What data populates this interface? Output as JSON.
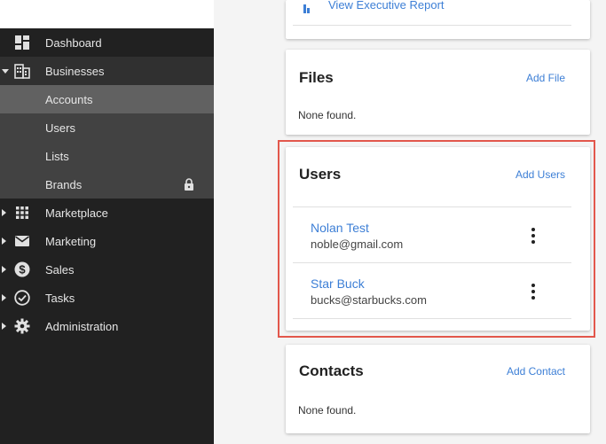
{
  "sidebar": {
    "items": [
      {
        "label": "Dashboard",
        "icon": "dashboard-icon",
        "caret": ""
      },
      {
        "label": "Businesses",
        "icon": "building-icon",
        "caret": "down"
      },
      {
        "label": "Accounts",
        "sub": true,
        "active": true
      },
      {
        "label": "Users",
        "sub": true
      },
      {
        "label": "Lists",
        "sub": true
      },
      {
        "label": "Brands",
        "sub": true,
        "locked": true
      },
      {
        "label": "Marketplace",
        "icon": "grid-icon",
        "caret": "right"
      },
      {
        "label": "Marketing",
        "icon": "mail-icon",
        "caret": "right"
      },
      {
        "label": "Sales",
        "icon": "dollar-icon",
        "caret": "right"
      },
      {
        "label": "Tasks",
        "icon": "check-circle-icon",
        "caret": "right"
      },
      {
        "label": "Administration",
        "icon": "gear-icon",
        "caret": "right"
      }
    ]
  },
  "report": {
    "link_label": "View Executive Report"
  },
  "files": {
    "title": "Files",
    "action": "Add File",
    "empty": "None found."
  },
  "users": {
    "title": "Users",
    "action": "Add Users",
    "rows": [
      {
        "name": "Nolan Test",
        "email": "noble@gmail.com"
      },
      {
        "name": "Star Buck",
        "email": "bucks@starbucks.com"
      }
    ]
  },
  "contacts": {
    "title": "Contacts",
    "action": "Add Contact",
    "empty": "None found."
  },
  "colors": {
    "accent": "#3d7fd6",
    "sidebar_bg": "#212121",
    "highlight": "#e2574c"
  }
}
